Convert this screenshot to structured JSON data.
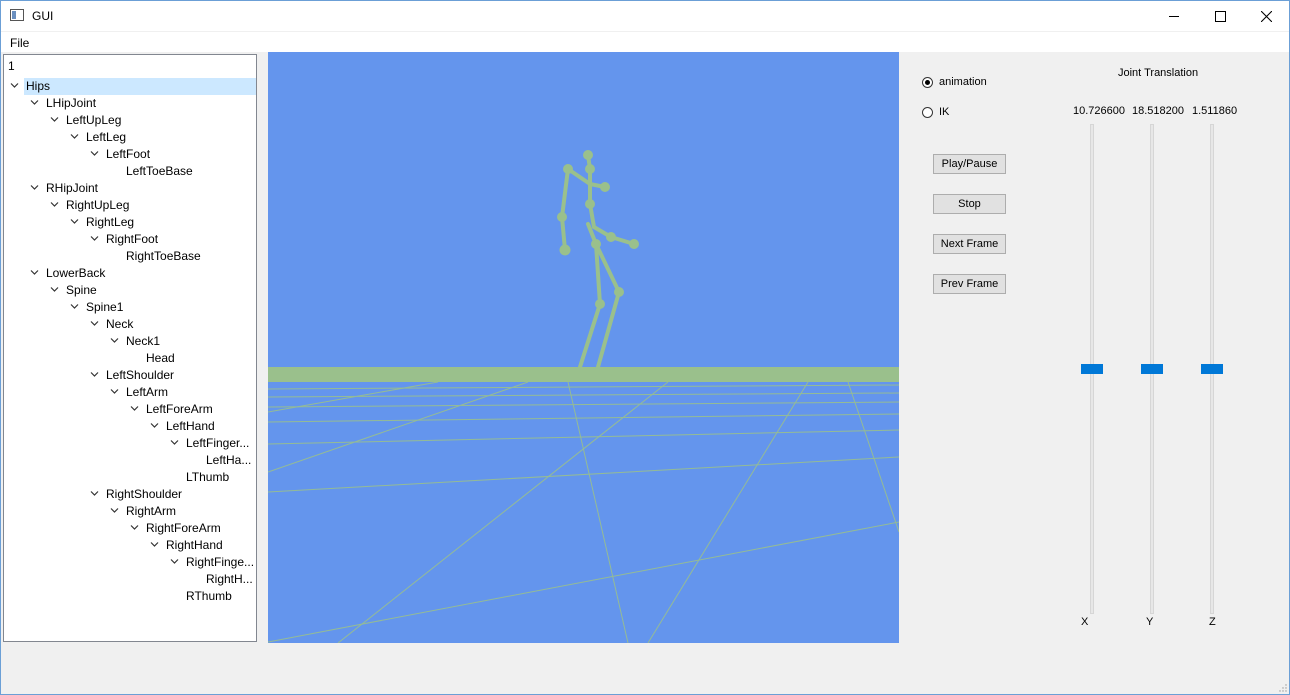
{
  "window": {
    "title": "GUI"
  },
  "menu": {
    "file": "File"
  },
  "tree": {
    "header": "1",
    "items": [
      {
        "label": "Hips",
        "depth": 0,
        "expanded": true,
        "selected": true
      },
      {
        "label": "LHipJoint",
        "depth": 1,
        "expanded": true
      },
      {
        "label": "LeftUpLeg",
        "depth": 2,
        "expanded": true
      },
      {
        "label": "LeftLeg",
        "depth": 3,
        "expanded": true
      },
      {
        "label": "LeftFoot",
        "depth": 4,
        "expanded": true
      },
      {
        "label": "LeftToeBase",
        "depth": 5,
        "expanded": false
      },
      {
        "label": "RHipJoint",
        "depth": 1,
        "expanded": true
      },
      {
        "label": "RightUpLeg",
        "depth": 2,
        "expanded": true
      },
      {
        "label": "RightLeg",
        "depth": 3,
        "expanded": true
      },
      {
        "label": "RightFoot",
        "depth": 4,
        "expanded": true
      },
      {
        "label": "RightToeBase",
        "depth": 5,
        "expanded": false
      },
      {
        "label": "LowerBack",
        "depth": 1,
        "expanded": true
      },
      {
        "label": "Spine",
        "depth": 2,
        "expanded": true
      },
      {
        "label": "Spine1",
        "depth": 3,
        "expanded": true
      },
      {
        "label": "Neck",
        "depth": 4,
        "expanded": true
      },
      {
        "label": "Neck1",
        "depth": 5,
        "expanded": true
      },
      {
        "label": "Head",
        "depth": 6,
        "expanded": false
      },
      {
        "label": "LeftShoulder",
        "depth": 4,
        "expanded": true
      },
      {
        "label": "LeftArm",
        "depth": 5,
        "expanded": true
      },
      {
        "label": "LeftForeArm",
        "depth": 6,
        "expanded": true
      },
      {
        "label": "LeftHand",
        "depth": 7,
        "expanded": true
      },
      {
        "label": "LeftFinger...",
        "depth": 8,
        "expanded": true
      },
      {
        "label": "LeftHa...",
        "depth": 9,
        "expanded": false
      },
      {
        "label": "LThumb",
        "depth": 8,
        "expanded": false
      },
      {
        "label": "RightShoulder",
        "depth": 4,
        "expanded": true
      },
      {
        "label": "RightArm",
        "depth": 5,
        "expanded": true
      },
      {
        "label": "RightForeArm",
        "depth": 6,
        "expanded": true
      },
      {
        "label": "RightHand",
        "depth": 7,
        "expanded": true
      },
      {
        "label": "RightFinge...",
        "depth": 8,
        "expanded": true
      },
      {
        "label": "RightH...",
        "depth": 9,
        "expanded": false
      },
      {
        "label": "RThumb",
        "depth": 8,
        "expanded": false
      }
    ]
  },
  "controls": {
    "mode_animation": "animation",
    "mode_ik": "IK",
    "selected_mode": "animation",
    "play_pause": "Play/Pause",
    "stop": "Stop",
    "next_frame": "Next Frame",
    "prev_frame": "Prev Frame",
    "joint_translation_title": "Joint Translation",
    "sliders": [
      {
        "axis": "X",
        "value": "10.726600",
        "level": 0.5
      },
      {
        "axis": "Y",
        "value": "18.518200",
        "level": 0.5
      },
      {
        "axis": "Z",
        "value": "1.511860",
        "level": 0.5
      }
    ]
  },
  "colors": {
    "viewport_bg": "#6495ed",
    "ground_and_skeleton": "#9ac08c",
    "slider_handle": "#0078d7",
    "selection": "#cce8ff"
  }
}
